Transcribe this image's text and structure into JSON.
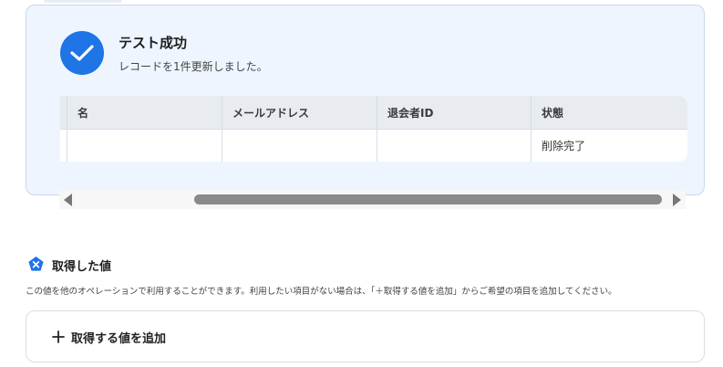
{
  "result": {
    "title": "テスト成功",
    "subtitle": "レコードを1件更新しました。",
    "status_icon": "check-icon",
    "accent_color": "#1f74e6"
  },
  "table": {
    "columns": [
      "名",
      "メールアドレス",
      "退会者ID",
      "状態"
    ],
    "rows": [
      [
        "",
        "",
        "",
        "削除完了"
      ]
    ]
  },
  "acquired": {
    "icon": "x-hexagon-icon",
    "title": "取得した値",
    "description": "この値を他のオペレーションで利用することができます。利用したい項目がない場合は、「＋取得する値を追加」からご希望の項目を追加してください。",
    "add_button_label": "取得する値を追加",
    "add_icon": "plus-icon"
  }
}
